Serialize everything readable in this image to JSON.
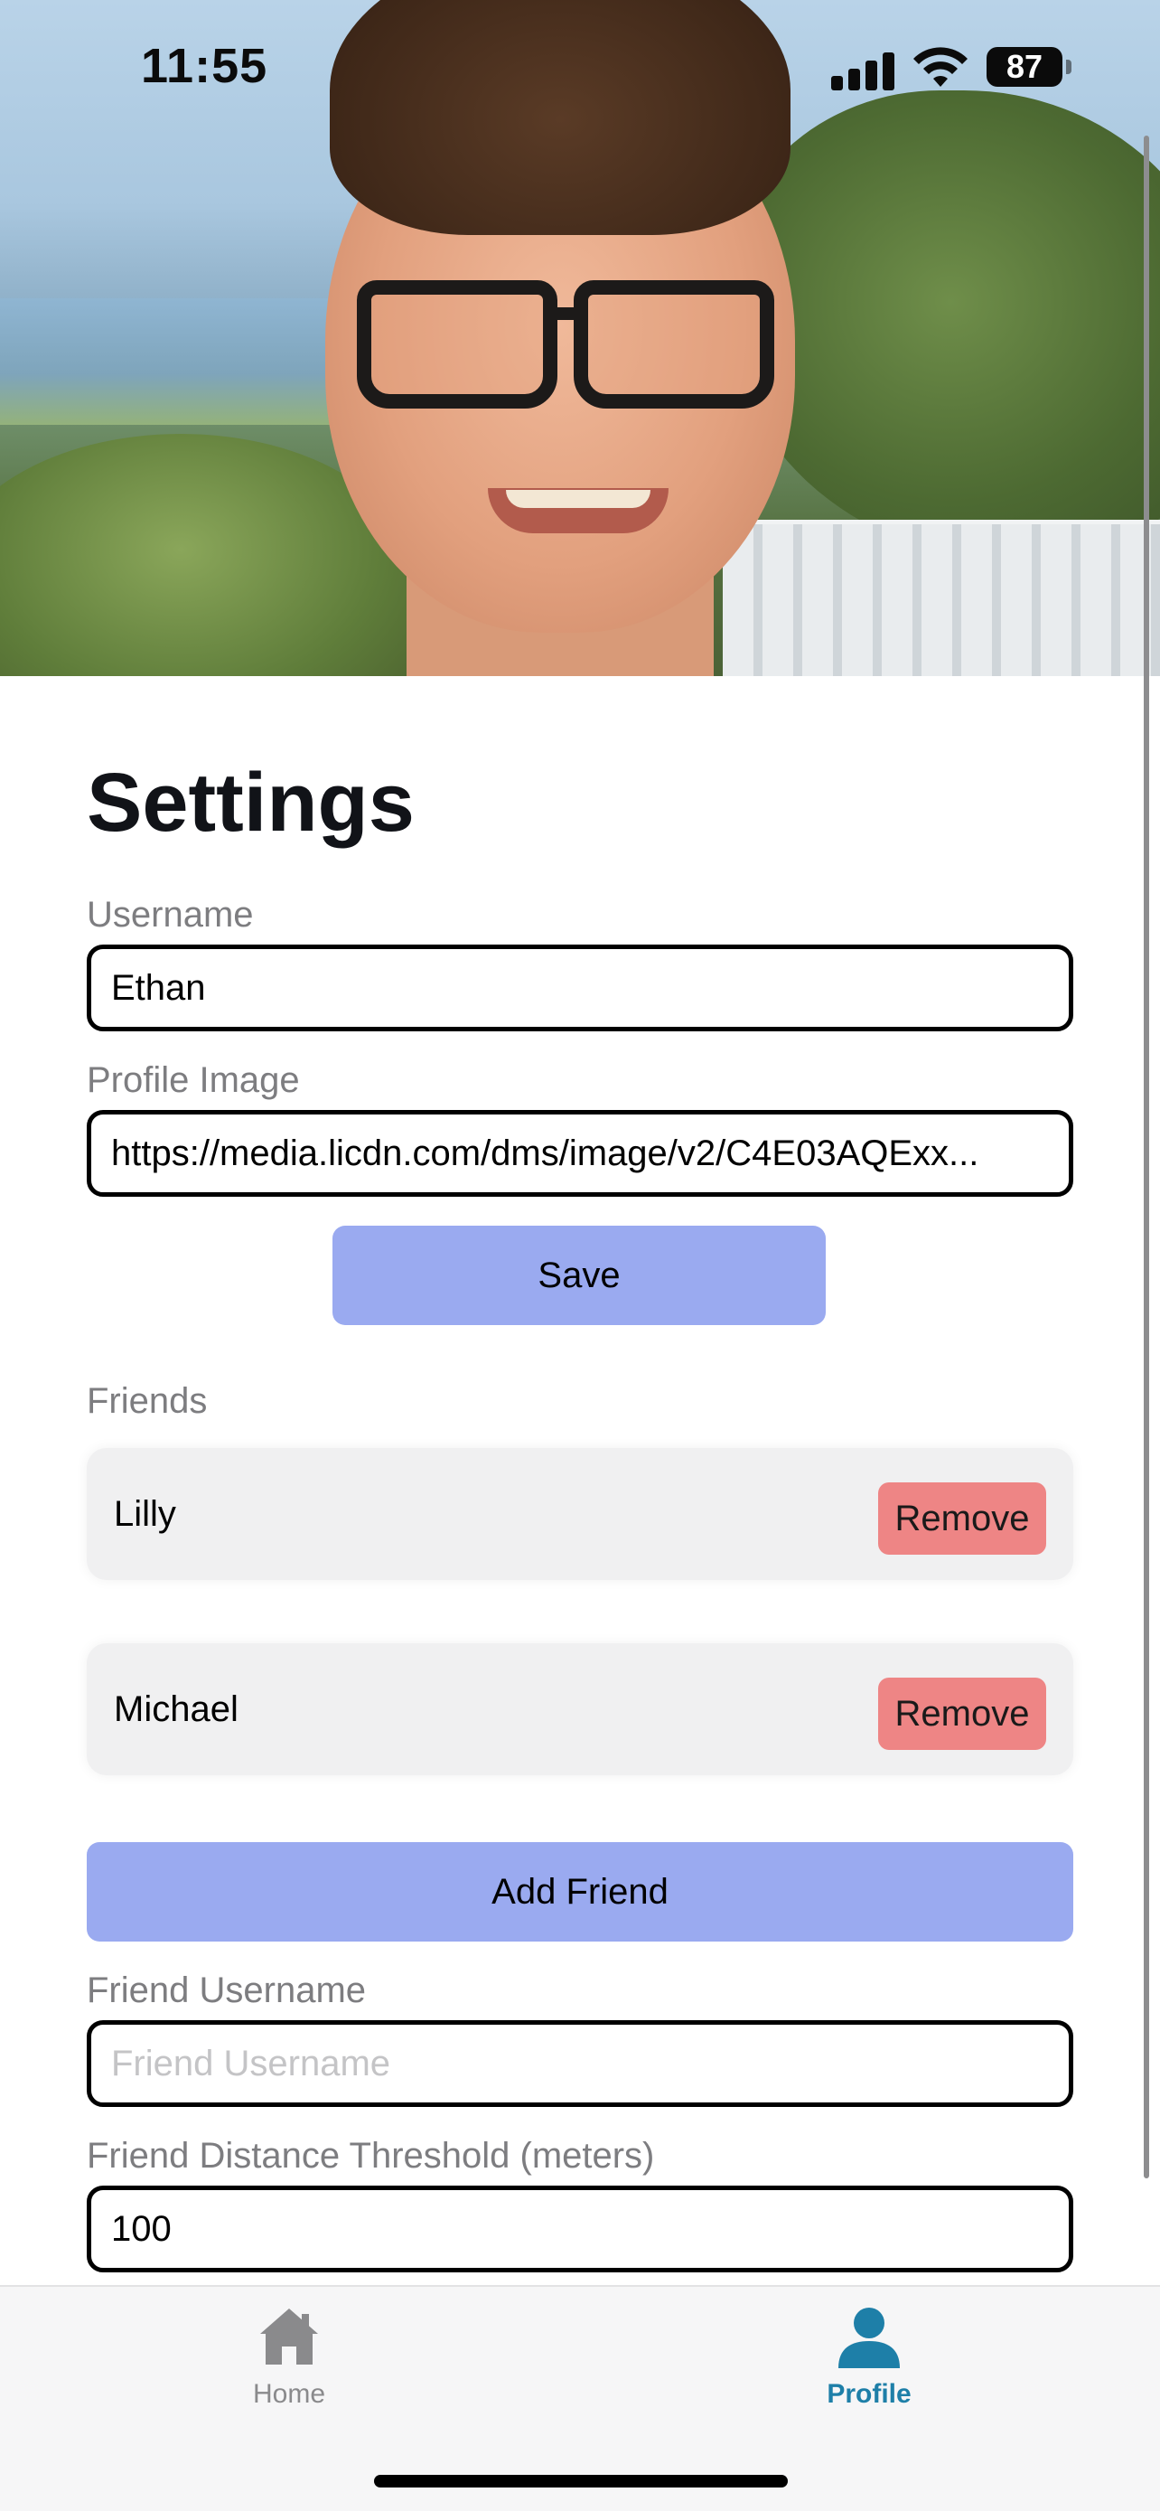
{
  "status_bar": {
    "time": "11:55",
    "battery": "87"
  },
  "settings": {
    "title": "Settings",
    "username": {
      "label": "Username",
      "value": "Ethan"
    },
    "profile_image": {
      "label": "Profile Image",
      "value": "https://media.licdn.com/dms/image/v2/C4E03AQExx..."
    },
    "save_label": "Save"
  },
  "friends": {
    "label": "Friends",
    "items": [
      {
        "name": "Lilly",
        "action": "Remove"
      },
      {
        "name": "Michael",
        "action": "Remove"
      }
    ],
    "add_label": "Add Friend",
    "friend_username": {
      "label": "Friend Username",
      "placeholder": "Friend Username",
      "value": ""
    },
    "distance_threshold": {
      "label": "Friend Distance Threshold (meters)",
      "value": "100"
    }
  },
  "tabbar": {
    "home_label": "Home",
    "profile_label": "Profile",
    "active": "Profile",
    "active_color": "#1e7fa8",
    "inactive_color": "#8a8a8c"
  },
  "colors": {
    "button_primary": "#9aaaf0",
    "button_remove": "#ee8585"
  }
}
